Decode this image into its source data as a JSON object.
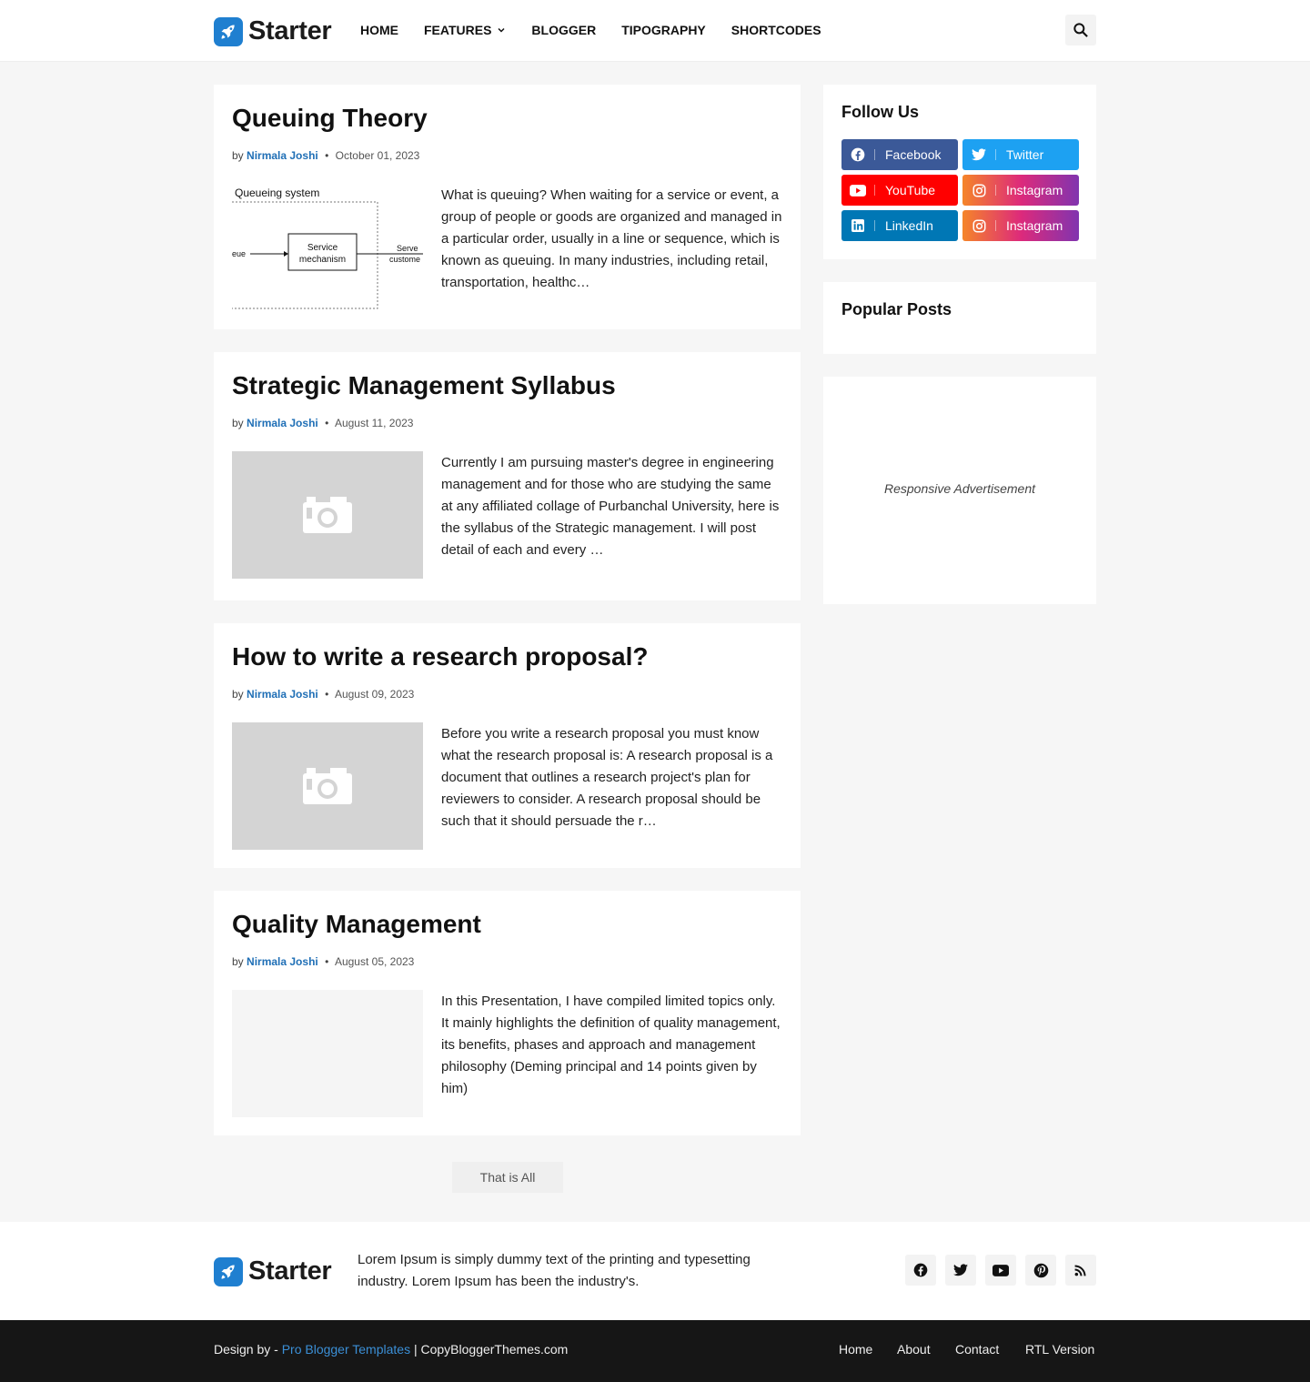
{
  "header": {
    "logo_text": "Starter",
    "nav": [
      "HOME",
      "FEATURES",
      "BLOGGER",
      "TIPOGRAPHY",
      "SHORTCODES"
    ]
  },
  "posts": [
    {
      "title": "Queuing Theory",
      "by": "by",
      "author": "Nirmala Joshi",
      "date": "October 01, 2023",
      "thumb": "diagram",
      "diagram": {
        "title": "Queueing system",
        "left": "eue",
        "box": [
          "Service",
          "mechanism"
        ],
        "right": [
          "Serve",
          "custome"
        ]
      },
      "excerpt": "What is queuing?   When waiting for a service or event, a group of people or goods are organized and managed in a particular order, usually in a line or sequence, which is known as queuing. In many industries, including retail, transportation, healthc…"
    },
    {
      "title": "Strategic Management Syllabus",
      "by": "by",
      "author": "Nirmala Joshi",
      "date": "August 11, 2023",
      "thumb": "camera",
      "excerpt": "Currently I am pursuing master's degree in engineering management and for those who are studying the same at any affiliated collage of Purbanchal University, here is the syllabus of the Strategic management. I will post detail of each and every …"
    },
    {
      "title": "How to write a research proposal?",
      "by": "by",
      "author": "Nirmala Joshi",
      "date": "August 09, 2023",
      "thumb": "camera",
      "excerpt": "Before you write a research proposal you must know what the research proposal is: A research proposal is a document that outlines a research project's plan for reviewers to consider. A research proposal should be such that it should persuade the r…"
    },
    {
      "title": "Quality Management",
      "by": "by",
      "author": "Nirmala Joshi",
      "date": "August 05, 2023",
      "thumb": "blank",
      "excerpt": "In this Presentation, I have compiled  limited topics only. It mainly highlights the definition of quality management, its benefits, phases and approach and management philosophy (Deming principal and 14 points given by him)"
    }
  ],
  "load_more": "That is All",
  "sidebar": {
    "follow_title": "Follow Us",
    "social": [
      {
        "label": "Facebook",
        "icon": "facebook-icon",
        "color": "#3b5998"
      },
      {
        "label": "Twitter",
        "icon": "twitter-icon",
        "color": "#1da1f2"
      },
      {
        "label": "YouTube",
        "icon": "youtube-icon",
        "color": "#ff0000"
      },
      {
        "label": "Instagram",
        "icon": "instagram-icon",
        "color": "#c13584"
      },
      {
        "label": "LinkedIn",
        "icon": "linkedin-icon",
        "color": "#0077b5"
      },
      {
        "label": "Instagram",
        "icon": "instagram-icon",
        "color": "#c13584"
      }
    ],
    "popular_title": "Popular Posts",
    "ad_text": "Responsive Advertisement"
  },
  "footer": {
    "logo_text": "Starter",
    "about": "Lorem Ipsum is simply dummy text of the printing and typesetting industry. Lorem Ipsum has been the industry's.",
    "social_icons": [
      "facebook-icon",
      "twitter-icon",
      "youtube-icon",
      "pinterest-icon",
      "rss-icon"
    ],
    "credit_prefix": "Design by - ",
    "credit_link": "Pro Blogger Templates",
    "credit_suffix": " | CopyBloggerThemes.com",
    "menu": [
      "Home",
      "About",
      "Contact",
      "RTL Version"
    ]
  },
  "colors": {
    "accent": "#1f7fd0",
    "author": "#1f6fb6",
    "footer_bg": "#161616"
  }
}
